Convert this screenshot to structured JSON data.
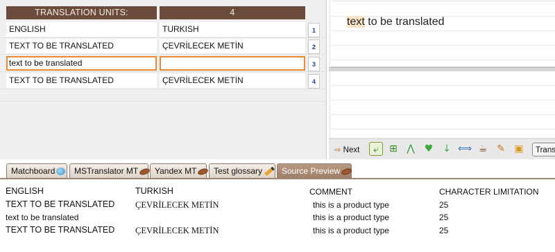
{
  "grid": {
    "header_label": "TRANSLATION UNITS:",
    "header_count": "4",
    "rows": [
      {
        "source": "ENGLISH",
        "target": "TURKISH",
        "num": "1"
      },
      {
        "source": "TEXT TO BE TRANSLATED",
        "target": "ÇEVRİLECEK METİN",
        "num": "2"
      },
      {
        "source": "text to be translated",
        "target": "",
        "num": "3"
      },
      {
        "source": "TEXT TO BE TRANSLATED",
        "target": "ÇEVRİLECEK METİN",
        "num": "4"
      }
    ]
  },
  "editor": {
    "source_highlight": "text",
    "source_rest": " to be translated",
    "target_text": ""
  },
  "toolbar": {
    "next_label": "Next",
    "trans_label": "Trans",
    "icons": [
      "insert-icon",
      "insert-next-icon",
      "tree-icon",
      "heart-check-icon",
      "arrow-down-icon",
      "swap-tags-icon",
      "coffee-icon",
      "pencil-edit-icon",
      "note-icon"
    ]
  },
  "tabs": [
    {
      "label": "Matchboard",
      "icon": "globe-icon"
    },
    {
      "label": "MSTranslator MT",
      "icon": "bean-icon"
    },
    {
      "label": "Yandex MT",
      "icon": "bean-icon"
    },
    {
      "label": "Test glossary",
      "icon": "pencil-icon"
    },
    {
      "label": "Source Preview",
      "icon": "bean-icon",
      "active": true
    }
  ],
  "preview": {
    "headers": [
      "ENGLISH",
      "TURKISH",
      "COMMENT",
      "CHARACTER LIMITATION"
    ],
    "rows": [
      [
        "TEXT TO BE TRANSLATED",
        "ÇEVRİLECEK METİN",
        "this is a product type",
        "25"
      ],
      [
        "text to be translated",
        "",
        "this is a product type",
        "25"
      ],
      [
        "TEXT TO BE TRANSLATED",
        "ÇEVRİLECEK METİN",
        "this is a product type",
        "25"
      ]
    ]
  },
  "colors": {
    "header_brown": "#6b4b3c",
    "active_border": "#e98a35",
    "highlight": "#f8e5c6"
  }
}
